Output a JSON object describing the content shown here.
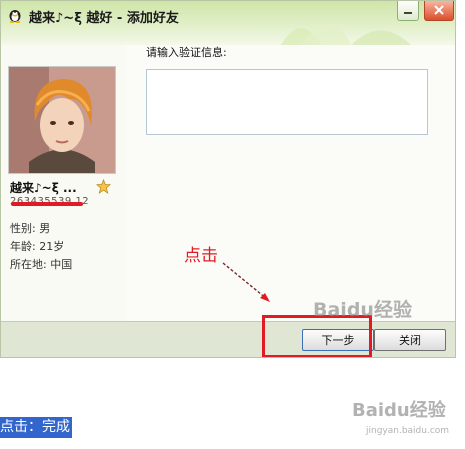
{
  "window": {
    "title": "越来♪~ξ 越好 - 添加好友"
  },
  "profile": {
    "nickname": "越来♪~ξ ...",
    "qq_number": "263435539.12",
    "gender": "性别: 男",
    "age": "年龄: 21岁",
    "location": "所在地: 中国"
  },
  "form": {
    "prompt": "请输入验证信息:",
    "value": ""
  },
  "annotation": {
    "text": "点击"
  },
  "buttons": {
    "next": "下一步",
    "close": "关闭"
  },
  "caption": {
    "text": "点击：完成"
  },
  "watermark": {
    "brand": "Baidu经验",
    "url": "jingyan.baidu.com"
  },
  "colors": {
    "highlight": "#e01b24",
    "caption_bg": "#3366cc"
  }
}
